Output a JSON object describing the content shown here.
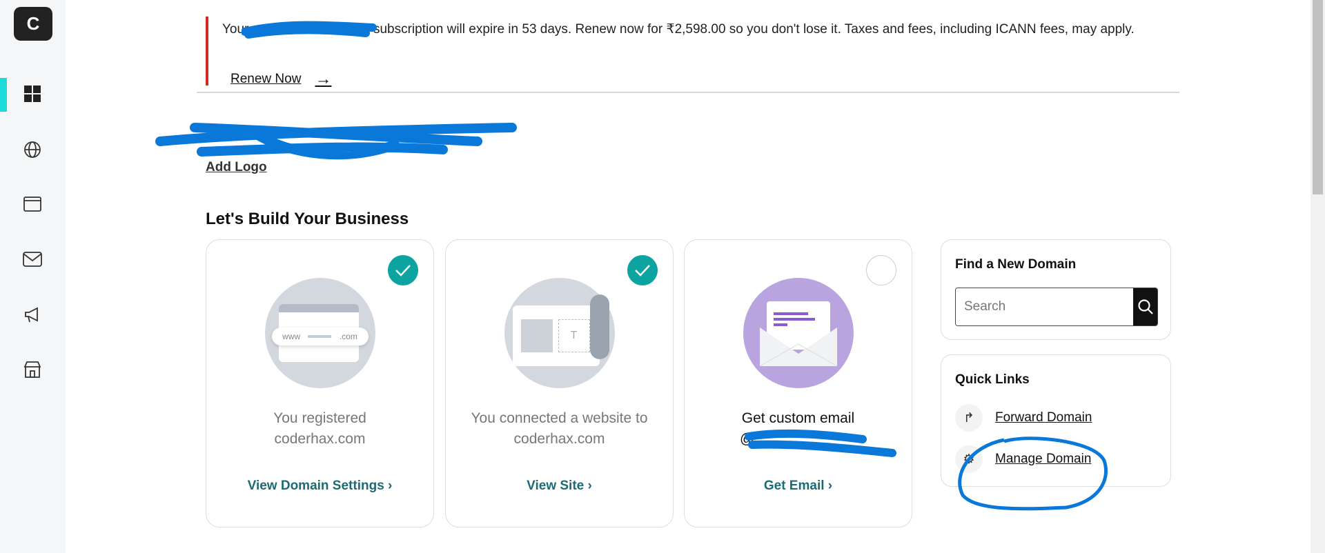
{
  "sidebar": {
    "logo_letter": "C",
    "items": [
      {
        "name": "dashboard",
        "icon": "grid-icon",
        "active": true
      },
      {
        "name": "domains",
        "icon": "globe-icon"
      },
      {
        "name": "websites",
        "icon": "browser-window-icon"
      },
      {
        "name": "email",
        "icon": "mail-icon"
      },
      {
        "name": "marketing",
        "icon": "megaphone-icon"
      },
      {
        "name": "commerce",
        "icon": "storefront-icon"
      }
    ],
    "accent": "#1bdbdb"
  },
  "banner": {
    "text_start": "Your",
    "text_end": "subscription will expire in 53 days. Renew now for ₹2,598.00 so you don't lose it. Taxes and fees, including ICANN fees, may apply.",
    "renew_label": "Renew Now",
    "accent": "#d42a1e"
  },
  "profile": {
    "add_logo": "Add Logo"
  },
  "section": {
    "title": "Let's Build Your Business"
  },
  "cards": [
    {
      "text_line1": "You registered",
      "text_line2": "coderhax.com",
      "link": "View Domain Settings",
      "completed": true
    },
    {
      "text_line1": "You connected a website to",
      "text_line2": "coderhax.com",
      "link": "View Site",
      "completed": true
    },
    {
      "text_line1": "Get custom email",
      "text_line2": "@",
      "link": "Get Email",
      "completed": false
    }
  ],
  "illustration": {
    "www": "www",
    "com": ".com",
    "t": "T"
  },
  "find_domain": {
    "title": "Find a New Domain",
    "placeholder": "Search"
  },
  "quick_links": {
    "title": "Quick Links",
    "items": [
      {
        "label": "Forward Domain",
        "icon": "forward-arrow-icon"
      },
      {
        "label": "Manage Domain",
        "icon": "gear-icon"
      }
    ]
  },
  "colors": {
    "link": "#1c6b74",
    "check": "#0ca3a0",
    "email_circle": "#b9a4e0",
    "redaction": "#0a78d8"
  }
}
